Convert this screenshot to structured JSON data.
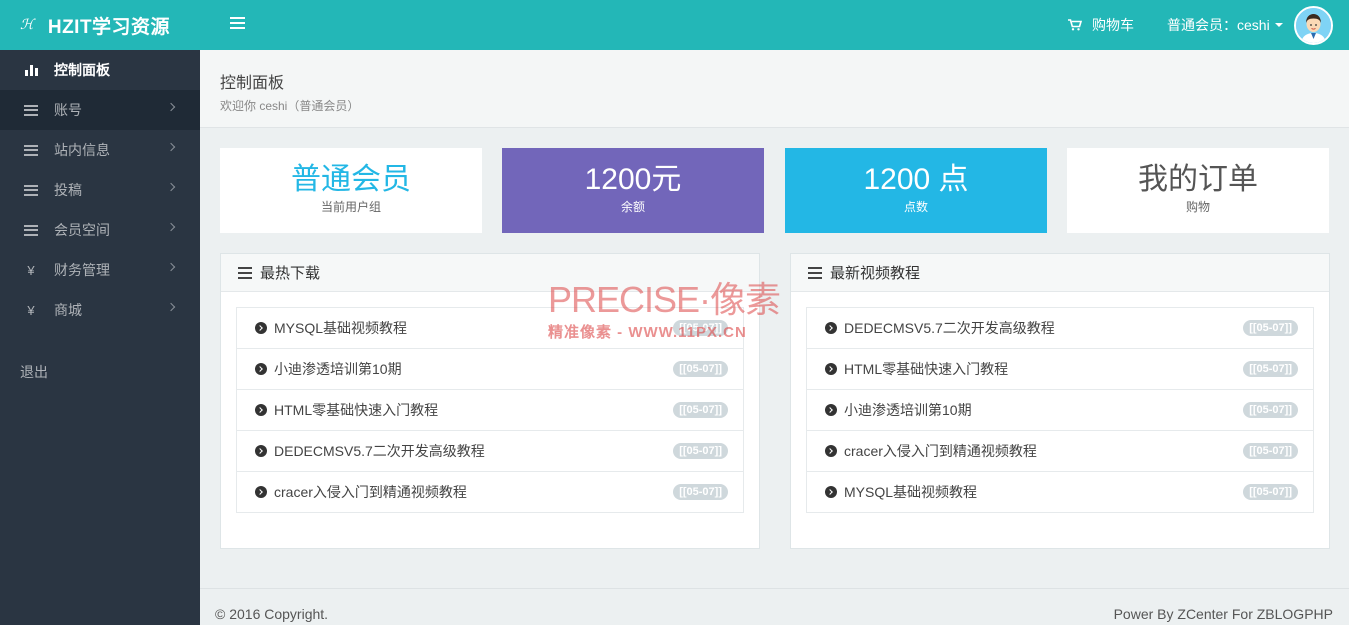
{
  "header": {
    "logo_mark": "ℋ",
    "logo_text": "HZIT学习资源",
    "cart_label": "购物车",
    "user_label": "普通会员：ceshi"
  },
  "sidebar": {
    "items": [
      {
        "label": "控制面板",
        "icon": "bar-chart-icon"
      },
      {
        "label": "账号",
        "icon": "list-icon"
      },
      {
        "label": "站内信息",
        "icon": "list-icon"
      },
      {
        "label": "投稿",
        "icon": "list-icon"
      },
      {
        "label": "会员空间",
        "icon": "list-icon"
      },
      {
        "label": "财务管理",
        "icon": "yen-icon"
      },
      {
        "label": "商城",
        "icon": "yen-icon"
      }
    ],
    "logout": "退出"
  },
  "page": {
    "title": "控制面板",
    "subtitle": "欢迎你 ceshi（普通会员）"
  },
  "cards": [
    {
      "value": "普通会员",
      "label": "当前用户组",
      "color": "#23b7e5"
    },
    {
      "value": "1200元",
      "label": "余额",
      "color": "#7266ba"
    },
    {
      "value": "1200 点",
      "label": "点数",
      "color": "#23b7e5"
    },
    {
      "value": "我的订单",
      "label": "购物",
      "color": "#555555"
    }
  ],
  "panels": {
    "downloads": {
      "title": "最热下载",
      "items": [
        {
          "text": "MYSQL基础视频教程",
          "date": "[[05-07]]"
        },
        {
          "text": "小迪渗透培训第10期",
          "date": "[[05-07]]"
        },
        {
          "text": "HTML零基础快速入门教程",
          "date": "[[05-07]]"
        },
        {
          "text": "DEDECMSV5.7二次开发高级教程",
          "date": "[[05-07]]"
        },
        {
          "text": "cracer入侵入门到精通视频教程",
          "date": "[[05-07]]"
        }
      ]
    },
    "videos": {
      "title": "最新视频教程",
      "items": [
        {
          "text": "DEDECMSV5.7二次开发高级教程",
          "date": "[[05-07]]"
        },
        {
          "text": "HTML零基础快速入门教程",
          "date": "[[05-07]]"
        },
        {
          "text": "小迪渗透培训第10期",
          "date": "[[05-07]]"
        },
        {
          "text": "cracer入侵入门到精通视频教程",
          "date": "[[05-07]]"
        },
        {
          "text": "MYSQL基础视频教程",
          "date": "[[05-07]]"
        }
      ]
    }
  },
  "watermark": {
    "main": "PRECISE·像素",
    "sub": "精准像素 - WWW.11PX.CN"
  },
  "footer": {
    "copyright": "© 2016 Copyright.",
    "powered": "Power By ZCenter For ZBLOGPHP"
  },
  "colors": {
    "topbar": "#23b7b7",
    "sidebar": "#2a3542",
    "purple": "#7266ba",
    "cyan": "#23b7e5"
  }
}
